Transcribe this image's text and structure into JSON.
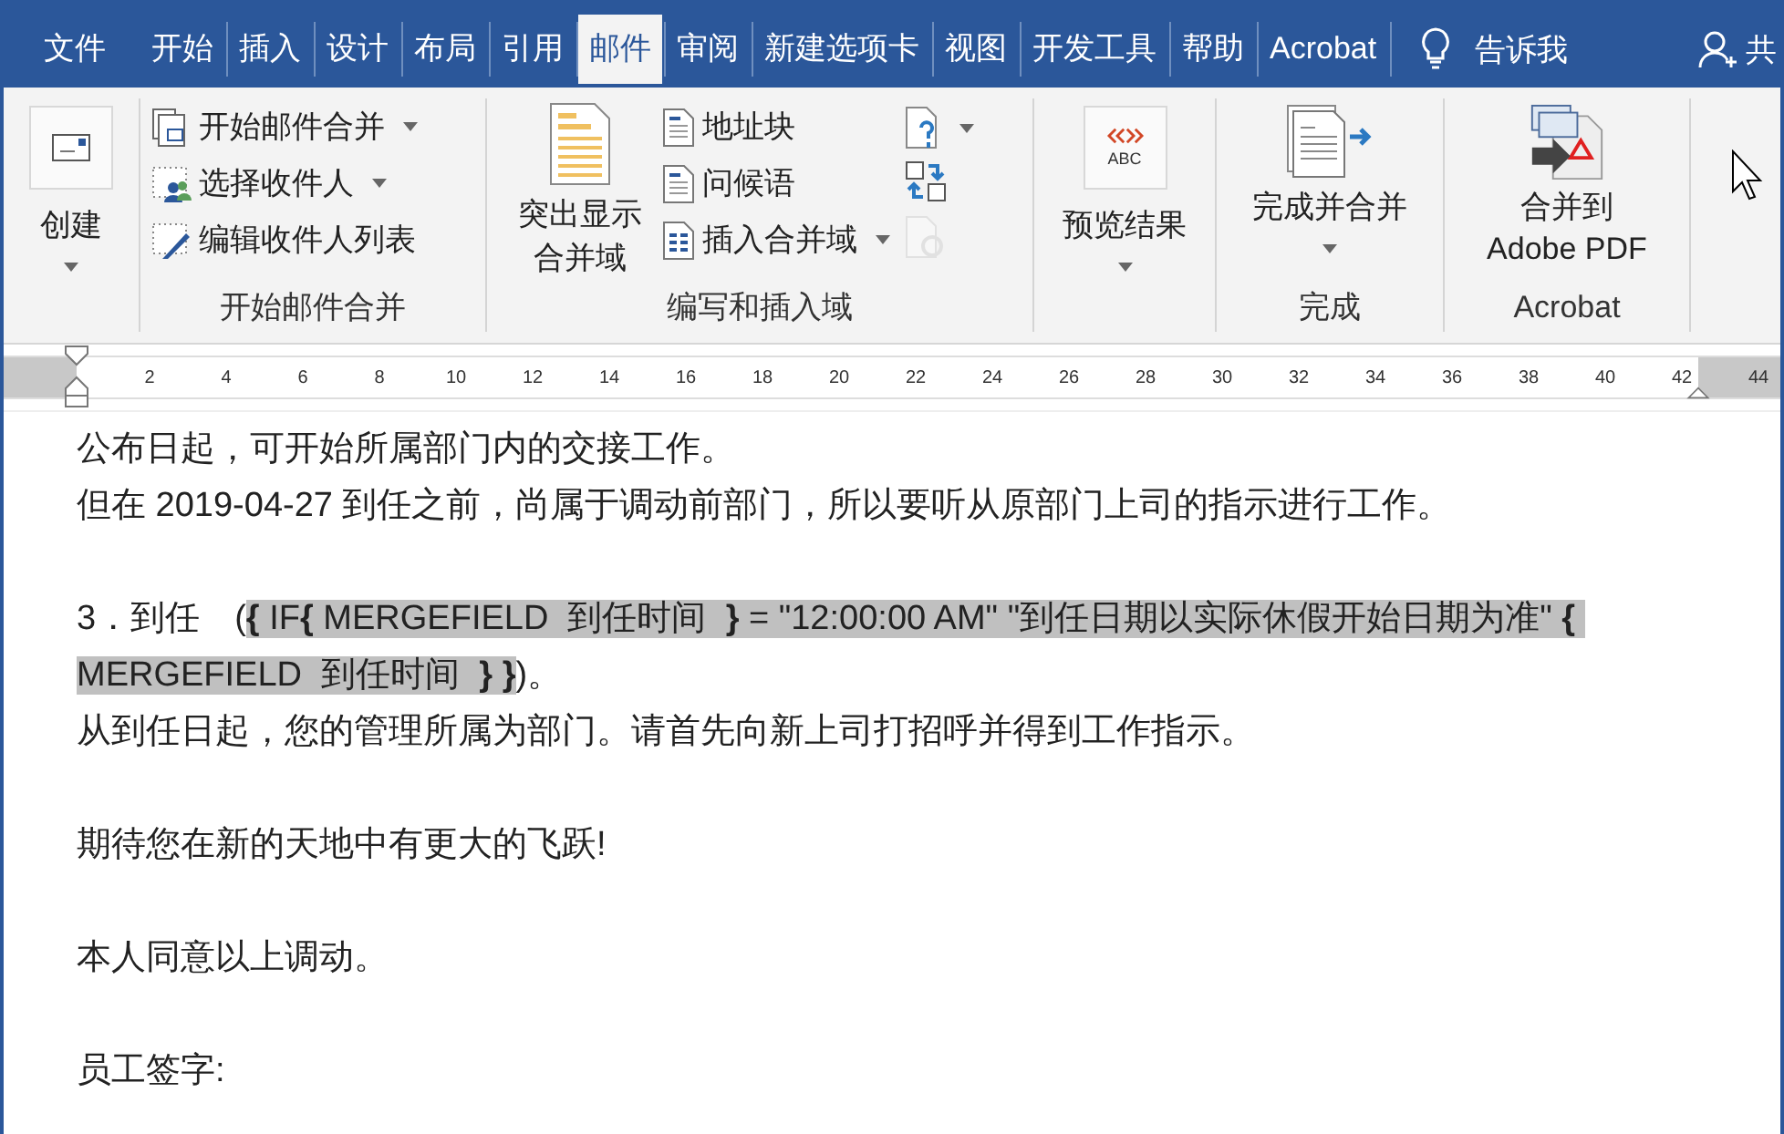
{
  "tabs": [
    {
      "label": "文件",
      "selected": false
    },
    {
      "label": "开始",
      "selected": false
    },
    {
      "label": "插入",
      "selected": false
    },
    {
      "label": "设计",
      "selected": false
    },
    {
      "label": "布局",
      "selected": false
    },
    {
      "label": "引用",
      "selected": false
    },
    {
      "label": "邮件",
      "selected": true
    },
    {
      "label": "审阅",
      "selected": false
    },
    {
      "label": "新建选项卡",
      "selected": false
    },
    {
      "label": "视图",
      "selected": false
    },
    {
      "label": "开发工具",
      "selected": false
    },
    {
      "label": "帮助",
      "selected": false
    },
    {
      "label": "Acrobat",
      "selected": false
    }
  ],
  "tell_me": "告诉我",
  "share": "共",
  "ribbon": {
    "groups": [
      {
        "items": [
          {
            "label": "创建",
            "dropdown": true
          }
        ]
      },
      {
        "label": "开始邮件合并",
        "items": [
          {
            "label": "开始邮件合并",
            "dropdown": true
          },
          {
            "label": "选择收件人",
            "dropdown": true
          },
          {
            "label": "编辑收件人列表",
            "dropdown": false
          }
        ]
      },
      {
        "label": "编写和插入域",
        "items": [
          {
            "label": "突出显示合并域",
            "dropdown": false
          },
          {
            "label": "地址块",
            "dropdown": false
          },
          {
            "label": "问候语",
            "dropdown": false
          },
          {
            "label": "插入合并域",
            "dropdown": true
          },
          {
            "dropdown": true,
            "disabled": false
          },
          {
            "dropdown": false,
            "disabled": false
          },
          {
            "dropdown": false,
            "disabled": true
          }
        ]
      },
      {
        "items": [
          {
            "label": "预览结果",
            "dropdown": true,
            "icon_text": "ABC"
          }
        ]
      },
      {
        "label": "完成",
        "items": [
          {
            "label": "完成并合并",
            "dropdown": true
          }
        ]
      },
      {
        "label": "Acrobat",
        "items": [
          {
            "label": "合并到 Adobe PDF",
            "dropdown": false
          }
        ]
      }
    ]
  },
  "ruler": {
    "ticks": [
      "2",
      "4",
      "6",
      "8",
      "10",
      "12",
      "14",
      "16",
      "18",
      "20",
      "22",
      "24",
      "26",
      "28",
      "30",
      "32",
      "34",
      "36",
      "38",
      "40",
      "42",
      "44"
    ]
  },
  "document": {
    "blocks": [
      [
        {
          "kind": "text",
          "text": "公布日起，可开始所属部门内的交接工作。"
        },
        {
          "kind": "text",
          "text": "但在 2019-04-27 到任之前，尚属于调动前部门，所以要听从原部门上司的指示进行工作。"
        }
      ],
      [
        {
          "kind": "field",
          "before": "3．到任　(",
          "field": "**{** IF**{** MERGEFIELD  到任时间  **}** = \"12:00:00 AM\" \"到任日期以实际休假开始日期为准\" **{** MERGEFIELD  到任时间  **} }**",
          "after": ")。"
        },
        {
          "kind": "text",
          "text": "从到任日起，您的管理所属为部门。请首先向新上司打招呼并得到工作指示。"
        }
      ],
      [
        {
          "kind": "text",
          "text": "期待您在新的天地中有更大的飞跃!"
        }
      ],
      [
        {
          "kind": "text",
          "text": "本人同意以上调动。"
        }
      ],
      [
        {
          "kind": "text",
          "text": "员工签字:"
        }
      ]
    ]
  }
}
